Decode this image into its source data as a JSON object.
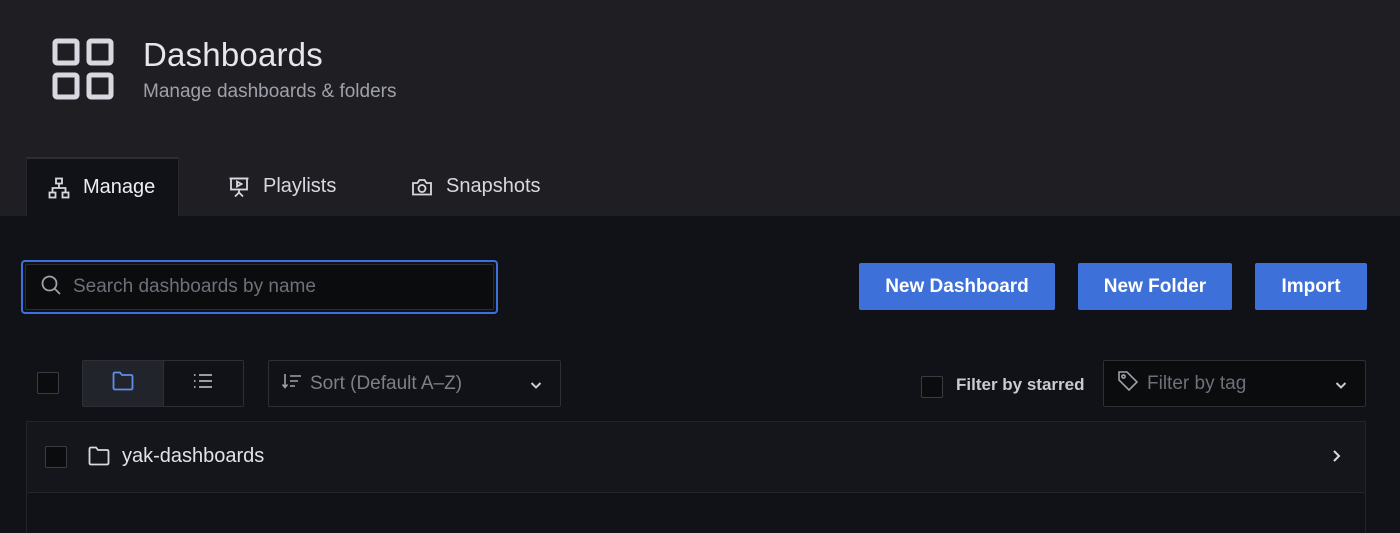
{
  "header": {
    "title": "Dashboards",
    "subtitle": "Manage dashboards & folders",
    "icon": "apps-grid-icon"
  },
  "tabs": [
    {
      "label": "Manage",
      "icon": "sitemap-icon",
      "active": true
    },
    {
      "label": "Playlists",
      "icon": "presentation-icon",
      "active": false
    },
    {
      "label": "Snapshots",
      "icon": "camera-icon",
      "active": false
    }
  ],
  "search": {
    "placeholder": "Search dashboards by name",
    "value": ""
  },
  "actions": {
    "new_dashboard": "New Dashboard",
    "new_folder": "New Folder",
    "import": "Import"
  },
  "toolbar": {
    "sort_placeholder": "Sort (Default A–Z)",
    "filter_starred_label": "Filter by starred",
    "filter_tag_placeholder": "Filter by tag",
    "view_mode": "folders"
  },
  "folders": [
    {
      "name": "yak-dashboards",
      "icon": "folder-icon"
    }
  ],
  "colors": {
    "accent": "#3d71d9",
    "header_bg": "#1f1f23",
    "page_bg": "#111217"
  }
}
